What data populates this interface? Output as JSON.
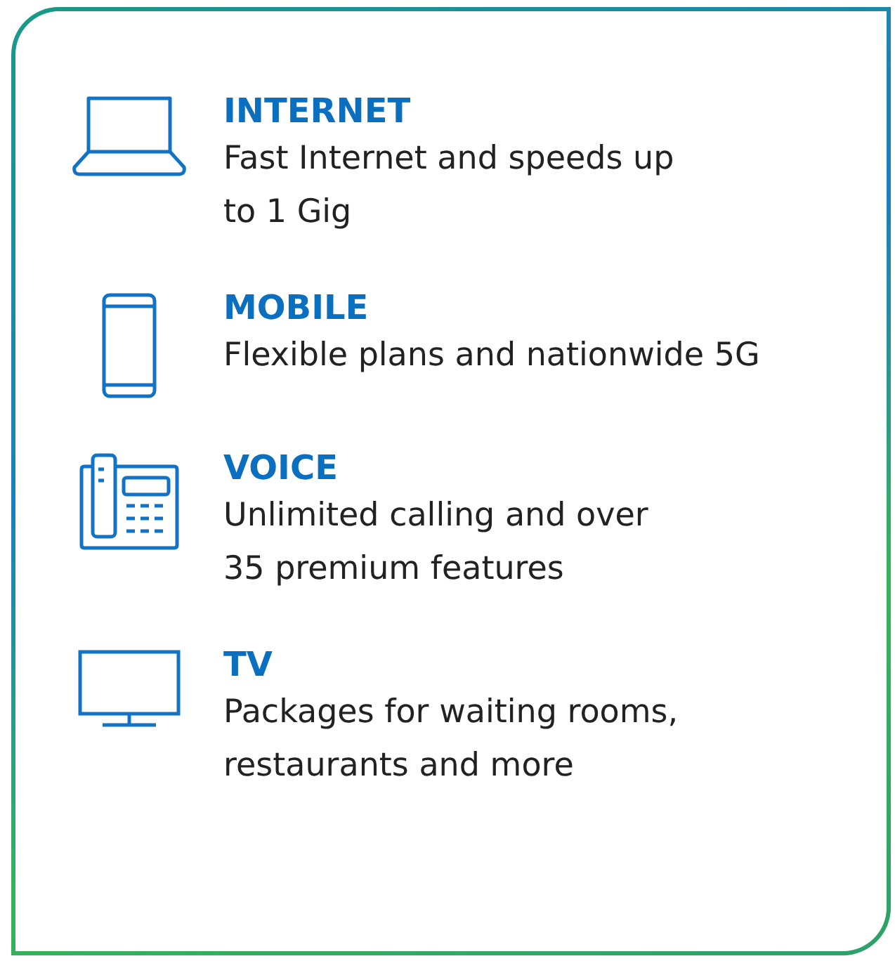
{
  "services": [
    {
      "kind": "laptop",
      "title": "INTERNET",
      "lines": [
        "Fast Internet and speeds up",
        "to 1 Gig"
      ]
    },
    {
      "kind": "phone",
      "title": "MOBILE",
      "lines": [
        "Flexible plans and nationwide 5G"
      ]
    },
    {
      "kind": "deskphone",
      "title": "VOICE",
      "lines": [
        "Unlimited calling and over",
        "35 premium features"
      ]
    },
    {
      "kind": "monitor",
      "title": "TV",
      "lines": [
        "Packages for waiting rooms,",
        "restaurants and more"
      ]
    }
  ]
}
